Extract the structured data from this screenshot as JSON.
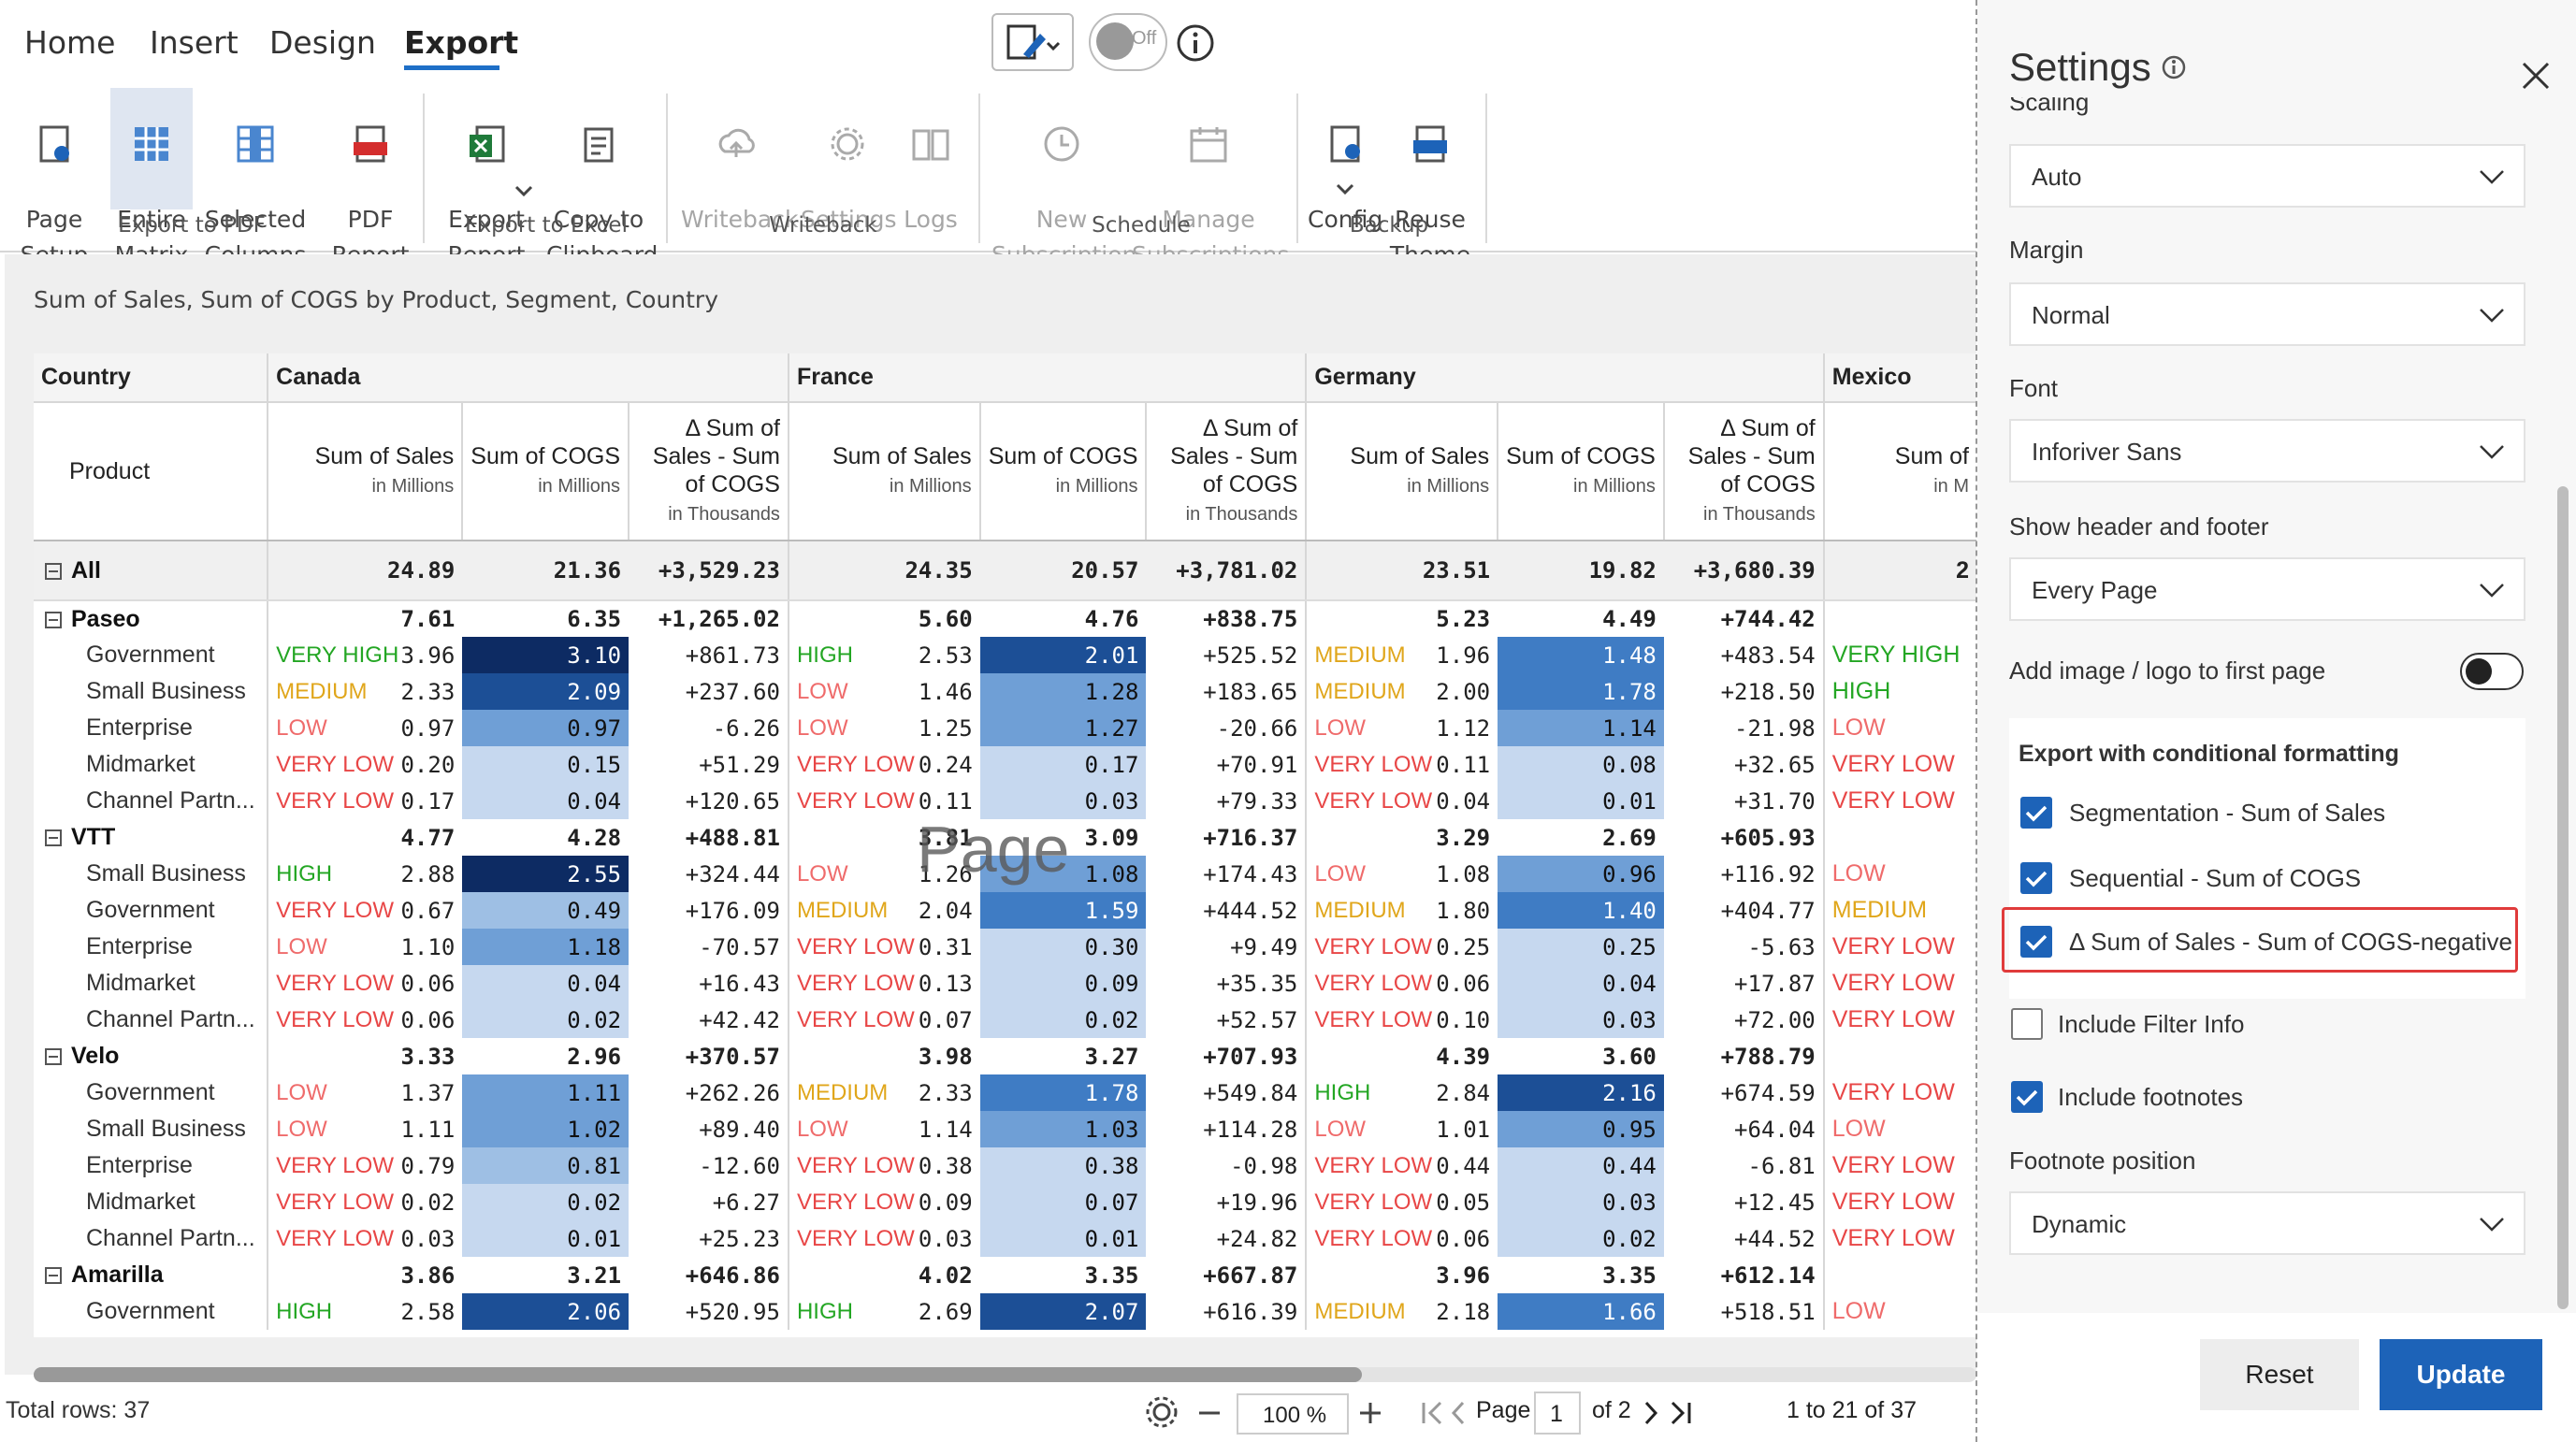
{
  "tabs": [
    "Home",
    "Insert",
    "Design",
    "Export"
  ],
  "toggle_label": "Off",
  "ribbon": {
    "page_setup": "Page\nSetup",
    "entire_matrix": "Entire\nMatrix",
    "selected_columns": "Selected\nColumns",
    "pdf_report": "PDF\nReport",
    "export_report": "Export\nReport",
    "copy_clipboard": "Copy to\nClipboard",
    "writeback": "Writeback",
    "settings": "Settings",
    "logs": "Logs",
    "new_subscription": "New\nSubscription",
    "manage_subscriptions": "Manage\nSubscriptions",
    "config": "Config",
    "reuse_theme": "Reuse\nTheme",
    "groups": [
      "Export to PDF",
      "Export to Excel",
      "Writeback",
      "Schedule",
      "Backup"
    ]
  },
  "report_title": "Sum of Sales, Sum of COGS by Product, Segment, Country",
  "watermark": "Page",
  "table": {
    "country_label": "Country",
    "product_label": "Product",
    "countries": [
      "Canada",
      "France",
      "Germany",
      "Mexico"
    ],
    "measures": [
      {
        "name": "Sum of Sales",
        "unit": "in Millions"
      },
      {
        "name": "Sum of COGS",
        "unit": "in Millions"
      },
      {
        "name": "Δ Sum of Sales - Sum of COGS",
        "unit": "in Thousands"
      }
    ],
    "mexico_partial": "Sum of",
    "mexico_partial_unit": "in M",
    "rows": [
      {
        "kind": "all",
        "label": "All",
        "c": [
          [
            "",
            "24.89",
            "21.36",
            "+3,529.23"
          ],
          [
            "",
            "24.35",
            "20.57",
            "+3,781.02"
          ],
          [
            "",
            "23.51",
            "19.82",
            "+3,680.39"
          ],
          [
            "",
            "2"
          ]
        ]
      },
      {
        "kind": "group",
        "label": "Paseo",
        "c": [
          [
            "",
            "7.61",
            "6.35",
            "+1,265.02"
          ],
          [
            "",
            "5.60",
            "4.76",
            "+838.75"
          ],
          [
            "",
            "5.23",
            "4.49",
            "+744.42"
          ],
          [
            "",
            ""
          ]
        ]
      },
      {
        "kind": "item",
        "label": "Government",
        "c": [
          [
            "VERY HIGH",
            "3.96",
            "3.10",
            "+861.73"
          ],
          [
            "HIGH",
            "2.53",
            "2.01",
            "+525.52"
          ],
          [
            "MEDIUM",
            "1.96",
            "1.48",
            "+483.54"
          ],
          [
            "VERY HIGH",
            ""
          ]
        ]
      },
      {
        "kind": "item",
        "label": "Small Business",
        "c": [
          [
            "MEDIUM",
            "2.33",
            "2.09",
            "+237.60"
          ],
          [
            "LOW",
            "1.46",
            "1.28",
            "+183.65"
          ],
          [
            "MEDIUM",
            "2.00",
            "1.78",
            "+218.50"
          ],
          [
            "HIGH",
            ""
          ]
        ]
      },
      {
        "kind": "item",
        "label": "Enterprise",
        "c": [
          [
            "LOW",
            "0.97",
            "0.97",
            "-6.26"
          ],
          [
            "LOW",
            "1.25",
            "1.27",
            "-20.66"
          ],
          [
            "LOW",
            "1.12",
            "1.14",
            "-21.98"
          ],
          [
            "LOW",
            ""
          ]
        ]
      },
      {
        "kind": "item",
        "label": "Midmarket",
        "c": [
          [
            "VERY LOW",
            "0.20",
            "0.15",
            "+51.29"
          ],
          [
            "VERY LOW",
            "0.24",
            "0.17",
            "+70.91"
          ],
          [
            "VERY LOW",
            "0.11",
            "0.08",
            "+32.65"
          ],
          [
            "VERY LOW",
            ""
          ]
        ]
      },
      {
        "kind": "item",
        "label": "Channel Partn...",
        "c": [
          [
            "VERY LOW",
            "0.17",
            "0.04",
            "+120.65"
          ],
          [
            "VERY LOW",
            "0.11",
            "0.03",
            "+79.33"
          ],
          [
            "VERY LOW",
            "0.04",
            "0.01",
            "+31.70"
          ],
          [
            "VERY LOW",
            ""
          ]
        ]
      },
      {
        "kind": "group",
        "label": "VTT",
        "c": [
          [
            "",
            "4.77",
            "4.28",
            "+488.81"
          ],
          [
            "",
            "3.81",
            "3.09",
            "+716.37"
          ],
          [
            "",
            "3.29",
            "2.69",
            "+605.93"
          ],
          [
            "",
            ""
          ]
        ]
      },
      {
        "kind": "item",
        "label": "Small Business",
        "c": [
          [
            "HIGH",
            "2.88",
            "2.55",
            "+324.44"
          ],
          [
            "LOW",
            "1.26",
            "1.08",
            "+174.43"
          ],
          [
            "LOW",
            "1.08",
            "0.96",
            "+116.92"
          ],
          [
            "LOW",
            ""
          ]
        ]
      },
      {
        "kind": "item",
        "label": "Government",
        "c": [
          [
            "VERY LOW",
            "0.67",
            "0.49",
            "+176.09"
          ],
          [
            "MEDIUM",
            "2.04",
            "1.59",
            "+444.52"
          ],
          [
            "MEDIUM",
            "1.80",
            "1.40",
            "+404.77"
          ],
          [
            "MEDIUM",
            ""
          ]
        ]
      },
      {
        "kind": "item",
        "label": "Enterprise",
        "c": [
          [
            "LOW",
            "1.10",
            "1.18",
            "-70.57"
          ],
          [
            "VERY LOW",
            "0.31",
            "0.30",
            "+9.49"
          ],
          [
            "VERY LOW",
            "0.25",
            "0.25",
            "-5.63"
          ],
          [
            "VERY LOW",
            ""
          ]
        ]
      },
      {
        "kind": "item",
        "label": "Midmarket",
        "c": [
          [
            "VERY LOW",
            "0.06",
            "0.04",
            "+16.43"
          ],
          [
            "VERY LOW",
            "0.13",
            "0.09",
            "+35.35"
          ],
          [
            "VERY LOW",
            "0.06",
            "0.04",
            "+17.87"
          ],
          [
            "VERY LOW",
            ""
          ]
        ]
      },
      {
        "kind": "item",
        "label": "Channel Partn...",
        "c": [
          [
            "VERY LOW",
            "0.06",
            "0.02",
            "+42.42"
          ],
          [
            "VERY LOW",
            "0.07",
            "0.02",
            "+52.57"
          ],
          [
            "VERY LOW",
            "0.10",
            "0.03",
            "+72.00"
          ],
          [
            "VERY LOW",
            ""
          ]
        ]
      },
      {
        "kind": "group",
        "label": "Velo",
        "c": [
          [
            "",
            "3.33",
            "2.96",
            "+370.57"
          ],
          [
            "",
            "3.98",
            "3.27",
            "+707.93"
          ],
          [
            "",
            "4.39",
            "3.60",
            "+788.79"
          ],
          [
            "",
            ""
          ]
        ]
      },
      {
        "kind": "item",
        "label": "Government",
        "c": [
          [
            "LOW",
            "1.37",
            "1.11",
            "+262.26"
          ],
          [
            "MEDIUM",
            "2.33",
            "1.78",
            "+549.84"
          ],
          [
            "HIGH",
            "2.84",
            "2.16",
            "+674.59"
          ],
          [
            "VERY LOW",
            ""
          ]
        ]
      },
      {
        "kind": "item",
        "label": "Small Business",
        "c": [
          [
            "LOW",
            "1.11",
            "1.02",
            "+89.40"
          ],
          [
            "LOW",
            "1.14",
            "1.03",
            "+114.28"
          ],
          [
            "LOW",
            "1.01",
            "0.95",
            "+64.04"
          ],
          [
            "LOW",
            ""
          ]
        ]
      },
      {
        "kind": "item",
        "label": "Enterprise",
        "c": [
          [
            "VERY LOW",
            "0.79",
            "0.81",
            "-12.60"
          ],
          [
            "VERY LOW",
            "0.38",
            "0.38",
            "-0.98"
          ],
          [
            "VERY LOW",
            "0.44",
            "0.44",
            "-6.81"
          ],
          [
            "VERY LOW",
            ""
          ]
        ]
      },
      {
        "kind": "item",
        "label": "Midmarket",
        "c": [
          [
            "VERY LOW",
            "0.02",
            "0.02",
            "+6.27"
          ],
          [
            "VERY LOW",
            "0.09",
            "0.07",
            "+19.96"
          ],
          [
            "VERY LOW",
            "0.05",
            "0.03",
            "+12.45"
          ],
          [
            "VERY LOW",
            ""
          ]
        ]
      },
      {
        "kind": "item",
        "label": "Channel Partn...",
        "c": [
          [
            "VERY LOW",
            "0.03",
            "0.01",
            "+25.23"
          ],
          [
            "VERY LOW",
            "0.03",
            "0.01",
            "+24.82"
          ],
          [
            "VERY LOW",
            "0.06",
            "0.02",
            "+44.52"
          ],
          [
            "VERY LOW",
            ""
          ]
        ]
      },
      {
        "kind": "group",
        "label": "Amarilla",
        "c": [
          [
            "",
            "3.86",
            "3.21",
            "+646.86"
          ],
          [
            "",
            "4.02",
            "3.35",
            "+667.87"
          ],
          [
            "",
            "3.96",
            "3.35",
            "+612.14"
          ],
          [
            "",
            ""
          ]
        ]
      },
      {
        "kind": "item",
        "label": "Government",
        "c": [
          [
            "HIGH",
            "2.58",
            "2.06",
            "+520.95"
          ],
          [
            "HIGH",
            "2.69",
            "2.07",
            "+616.39"
          ],
          [
            "MEDIUM",
            "2.18",
            "1.66",
            "+518.51"
          ],
          [
            "LOW",
            ""
          ]
        ]
      }
    ]
  },
  "status": {
    "total_rows": "Total rows: 37",
    "zoom": "100 %",
    "page_label": "Page",
    "page_value": "1",
    "page_of": "of 2",
    "range": "1 to 21 of 37"
  },
  "settings": {
    "title": "Settings",
    "cut_label": "Scaling",
    "scaling": "Auto",
    "margin_label": "Margin",
    "margin": "Normal",
    "font_label": "Font",
    "font": "Inforiver Sans",
    "header_label": "Show header and footer",
    "header": "Every Page",
    "logo_label": "Add image / logo to first page",
    "cf_title": "Export with conditional formatting",
    "cf_items": [
      "Segmentation - Sum of Sales",
      "Sequential - Sum of COGS",
      "Δ Sum of Sales - Sum of COGS-negative"
    ],
    "filter_info": "Include Filter Info",
    "footnotes": "Include footnotes",
    "footnote_pos_label": "Footnote position",
    "footnote_pos": "Dynamic",
    "reset": "Reset",
    "update": "Update"
  },
  "colors": {
    "accent": "#1d63b8",
    "highlight_border": "#e03b3b"
  }
}
